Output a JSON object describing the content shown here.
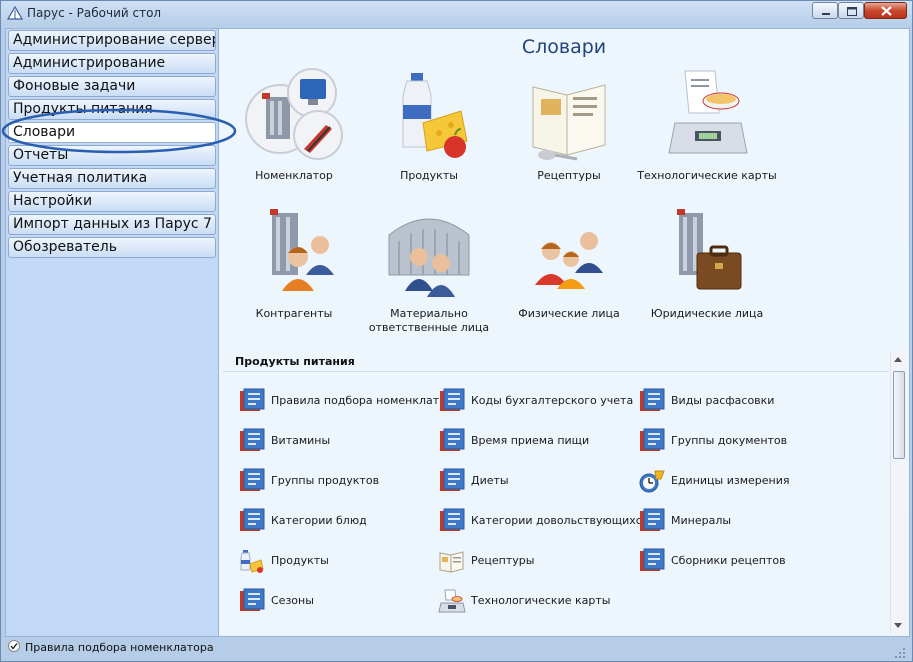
{
  "window": {
    "title": "Парус - Рабочий стол"
  },
  "sidebar": {
    "items": [
      {
        "label": "Администрирование сервера"
      },
      {
        "label": "Администрирование"
      },
      {
        "label": "Фоновые задачи"
      },
      {
        "label": "Продукты питания"
      },
      {
        "label": "Словари",
        "active": true
      },
      {
        "label": "Отчеты"
      },
      {
        "label": "Учетная политика"
      },
      {
        "label": "Настройки"
      },
      {
        "label": "Импорт данных из Парус 7"
      },
      {
        "label": "Обозреватель"
      }
    ]
  },
  "main": {
    "title": "Словари",
    "tiles": [
      {
        "label": "Номенклатор",
        "icon": "nomenclator-icon"
      },
      {
        "label": "Продукты",
        "icon": "products-icon"
      },
      {
        "label": "Рецептуры",
        "icon": "recipe-book-icon"
      },
      {
        "label": "Технологические карты",
        "icon": "tech-card-scale-icon"
      },
      {
        "label": "Контрагенты",
        "icon": "counterparties-icon"
      },
      {
        "label_line1": "Материально",
        "label_line2": "ответственные лица",
        "icon": "responsible-persons-icon"
      },
      {
        "label": "Физические лица",
        "icon": "individuals-icon"
      },
      {
        "label": "Юридические лица",
        "icon": "legal-entities-icon"
      }
    ],
    "section": {
      "title": "Продукты питания",
      "links": [
        {
          "label": "Правила подбора номенклат...",
          "icon": "book-icon"
        },
        {
          "label": "Коды бухгалтерского учета",
          "icon": "book-icon"
        },
        {
          "label": "Виды расфасовки",
          "icon": "book-icon"
        },
        {
          "label": "Витамины",
          "icon": "book-icon"
        },
        {
          "label": "Время приема пищи",
          "icon": "book-icon"
        },
        {
          "label": "Группы документов",
          "icon": "book-icon"
        },
        {
          "label": "Группы продуктов",
          "icon": "book-icon"
        },
        {
          "label": "Диеты",
          "icon": "book-icon"
        },
        {
          "label": "Единицы измерения",
          "icon": "units-clock-icon"
        },
        {
          "label": "Категории блюд",
          "icon": "book-icon"
        },
        {
          "label": "Категории довольствующихся",
          "icon": "book-icon"
        },
        {
          "label": "Минералы",
          "icon": "book-icon"
        },
        {
          "label": "Продукты",
          "icon": "products-small-icon"
        },
        {
          "label": "Рецептуры",
          "icon": "recipe-small-icon"
        },
        {
          "label": "Сборники рецептов",
          "icon": "book-icon"
        },
        {
          "label": "Сезоны",
          "icon": "book-icon"
        },
        {
          "label": "Технологические карты",
          "icon": "scale-small-icon"
        }
      ]
    }
  },
  "status": {
    "text": "Правила подбора номенклатора"
  },
  "colors": {
    "sidebar": "#c1d9f6",
    "main": "#eef6fd",
    "title": "#20447c",
    "annotation": "#2a5fb0"
  }
}
